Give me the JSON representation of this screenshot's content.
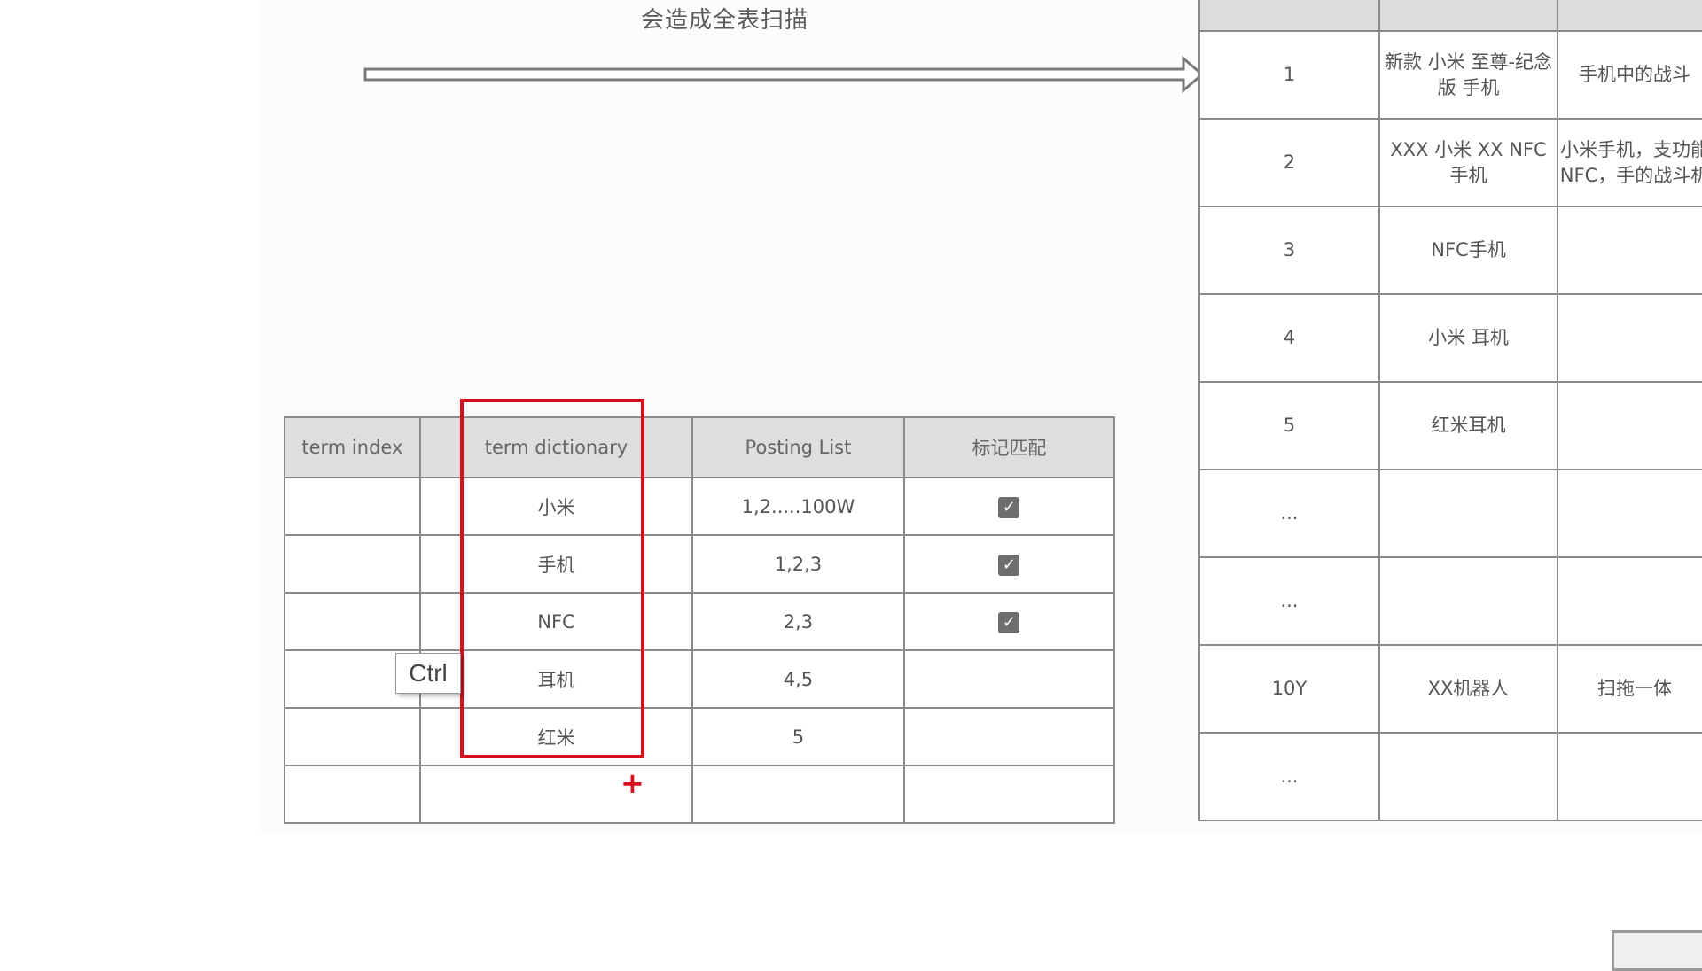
{
  "caption": "会造成全表扫描",
  "index_table": {
    "headers": [
      "term index",
      "term dictionary",
      "Posting List",
      "标记匹配"
    ],
    "rows": [
      {
        "term": "小米",
        "posting": "1,2.....100W",
        "matched": true
      },
      {
        "term": "手机",
        "posting": "1,2,3",
        "matched": true
      },
      {
        "term": "NFC",
        "posting": "2,3",
        "matched": true
      },
      {
        "term": "耳机",
        "posting": "4,5",
        "matched": false
      },
      {
        "term": "红米",
        "posting": "5",
        "matched": false
      },
      {
        "term": "",
        "posting": "",
        "matched": false
      }
    ]
  },
  "check_glyph": "✓",
  "plus_glyph": "+",
  "tooltip": "Ctrl",
  "docs_table": {
    "rows": [
      {
        "id": "1",
        "title": "新款 小米 至尊-纪念版 手机",
        "desc": "手机中的战斗"
      },
      {
        "id": "2",
        "title": "XXX 小米 XX NFC 手机",
        "desc": "小米手机，支功能NFC，手的战斗机"
      },
      {
        "id": "3",
        "title": "NFC手机",
        "desc": ""
      },
      {
        "id": "4",
        "title": "小米 耳机",
        "desc": ""
      },
      {
        "id": "5",
        "title": "红米耳机",
        "desc": ""
      },
      {
        "id": "...",
        "title": "",
        "desc": ""
      },
      {
        "id": "...",
        "title": "",
        "desc": ""
      },
      {
        "id": "10Y",
        "title": "XX机器人",
        "desc": "扫拖一体"
      },
      {
        "id": "...",
        "title": "",
        "desc": ""
      }
    ]
  },
  "colors": {
    "highlight": "#d60f1c",
    "header_bg": "#dedede",
    "grid": "#8a8a8a"
  }
}
